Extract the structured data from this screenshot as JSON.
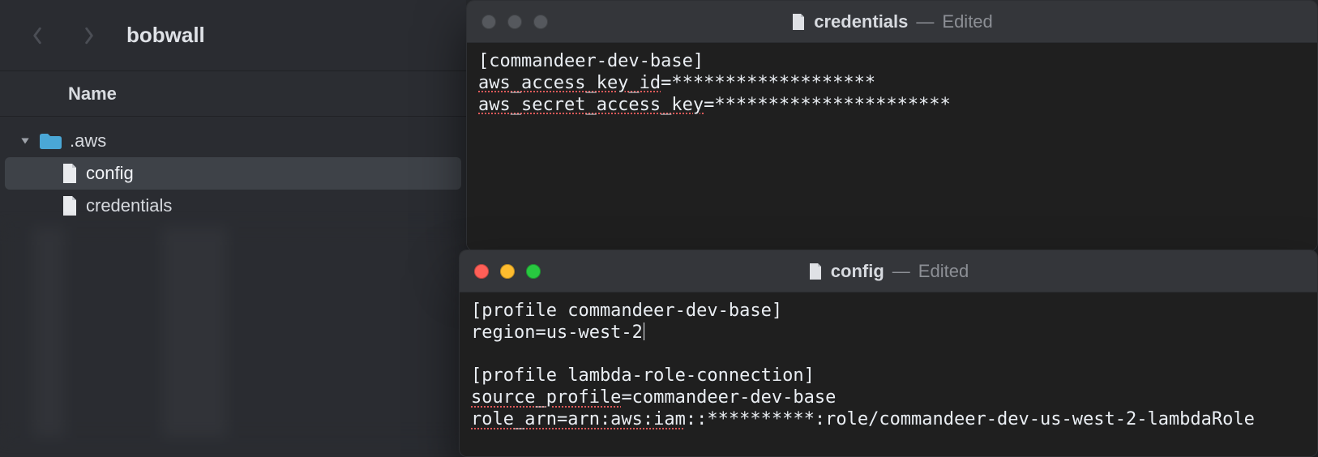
{
  "finder": {
    "title": "bobwall",
    "columns": {
      "name": "Name"
    },
    "rows": {
      "aws": {
        "label": ".aws",
        "expanded": true
      },
      "config": {
        "label": "config"
      },
      "credentials": {
        "label": "credentials"
      }
    }
  },
  "windows": {
    "credentials": {
      "filename": "credentials",
      "sep": "—",
      "status": "Edited",
      "traffic_dimmed": true,
      "content": {
        "line1": "[commandeer-dev-base]",
        "line2a": "aws_access_key_id",
        "line2b": "=*******************",
        "line3a": "aws_secret_access_key",
        "line3b": "=**********************"
      }
    },
    "config": {
      "filename": "config",
      "sep": "—",
      "status": "Edited",
      "traffic_dimmed": false,
      "content": {
        "line1": "[profile commandeer-dev-base]",
        "line2": "region=us-west-2",
        "blank": "",
        "line3": "[profile lambda-role-connection]",
        "line4a": "source_profile",
        "line4b": "=commandeer-dev-base",
        "line5a": "role_arn=arn:aws:iam",
        "line5b": "::**********:role/commandeer-dev-us-west-2-lambdaRole"
      }
    }
  }
}
